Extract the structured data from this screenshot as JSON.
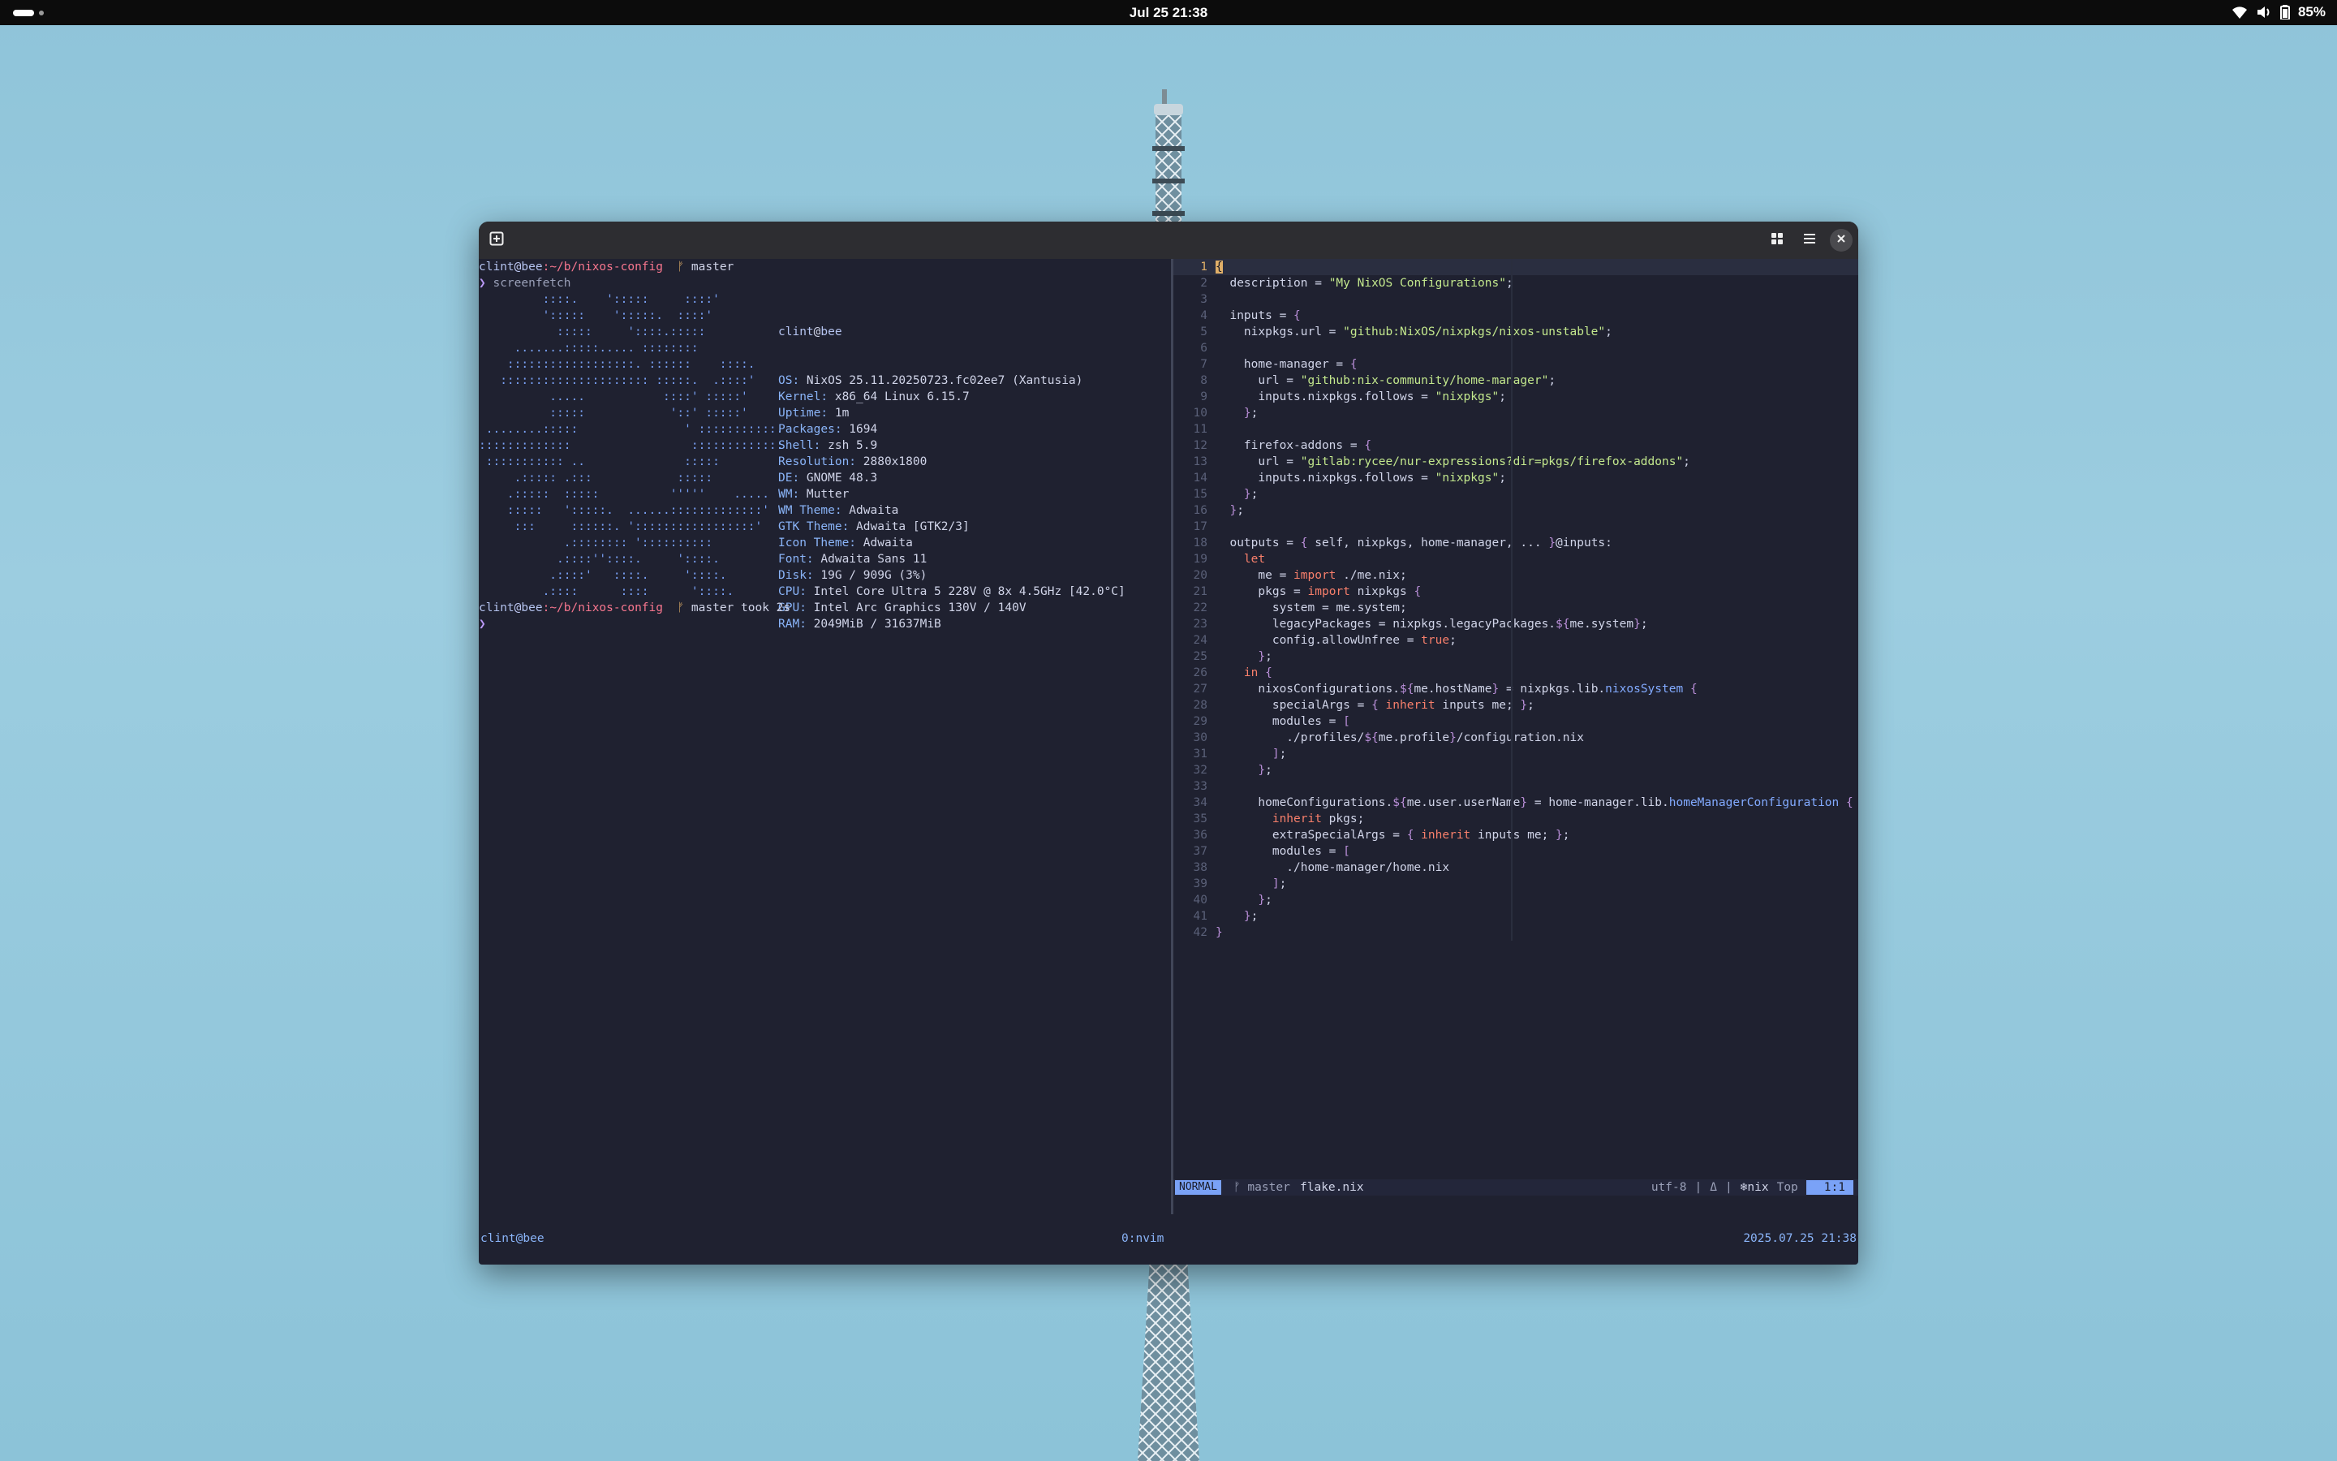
{
  "topbar": {
    "clock": "Jul 25  21:38",
    "battery": "85%"
  },
  "terminal": {
    "prompt1": {
      "user": "clint",
      "at": "@",
      "host": "bee",
      "path": ":~/b/nixos-config",
      "git_icon": "ᚠ",
      "branch": "master"
    },
    "cmd_arrow": "❯",
    "command": "screenfetch",
    "logo_lines": [
      "         ::::.    ':::::     ::::'",
      "         ':::::    ':::::.  ::::'",
      "           :::::     '::::.:::::",
      "     .......:::::..... ::::::::",
      "    ::::::::::::::::::. ::::::    ::::.",
      "   ::::::::::::::::::::: :::::.  .::::'",
      "          .....           ::::' :::::'",
      "          :::::            '::' :::::'",
      " ........:::::               ' :::::::::::.",
      ":::::::::::::                 :::::::::::::",
      " ::::::::::: ..              :::::",
      "     .::::: .:::            :::::",
      "    .:::::  :::::          '''''    .....",
      "    :::::   ':::::.  ......:::::::::::::'",
      "     :::     ::::::. ':::::::::::::::::'",
      "            .:::::::: '::::::::::",
      "           .::::''::::.     '::::.",
      "          .::::'   ::::.     '::::.",
      "         .::::      ::::      '::::."
    ],
    "info_title_user": "clint",
    "info_title_at": "@",
    "info_title_host": "bee",
    "info": [
      {
        "key": "OS:",
        "value": " NixOS 25.11.20250723.fc02ee7 (Xantusia)"
      },
      {
        "key": "Kernel:",
        "value": " x86_64 Linux 6.15.7"
      },
      {
        "key": "Uptime:",
        "value": " 1m"
      },
      {
        "key": "Packages:",
        "value": " 1694"
      },
      {
        "key": "Shell:",
        "value": " zsh 5.9"
      },
      {
        "key": "Resolution:",
        "value": " 2880x1800"
      },
      {
        "key": "DE:",
        "value": " GNOME 48.3"
      },
      {
        "key": "WM:",
        "value": " Mutter"
      },
      {
        "key": "WM Theme:",
        "value": " Adwaita"
      },
      {
        "key": "GTK Theme:",
        "value": " Adwaita [GTK2/3]"
      },
      {
        "key": "Icon Theme:",
        "value": " Adwaita"
      },
      {
        "key": "Font:",
        "value": " Adwaita Sans 11"
      },
      {
        "key": "Disk:",
        "value": " 19G / 909G (3%)"
      },
      {
        "key": "CPU:",
        "value": " Intel Core Ultra 5 228V @ 8x 4.5GHz [42.0°C]"
      },
      {
        "key": "GPU:",
        "value": " Intel Arc Graphics 130V / 140V"
      },
      {
        "key": "RAM:",
        "value": " 2049MiB / 31637MiB"
      }
    ],
    "prompt2_took": " took 2s"
  },
  "editor": {
    "line_numbers": [
      "1",
      "2",
      "3",
      "4",
      "5",
      "6",
      "7",
      "8",
      "9",
      "10",
      "11",
      "12",
      "13",
      "14",
      "15",
      "16",
      "17",
      "18",
      "19",
      "20",
      "21",
      "22",
      "23",
      "24",
      "25",
      "26",
      "27",
      "28",
      "29",
      "30",
      "31",
      "32",
      "33",
      "34",
      "35",
      "36",
      "37",
      "38",
      "39",
      "40",
      "41",
      "42"
    ],
    "code": [
      [
        [
          "p",
          "{"
        ]
      ],
      [
        [
          "w",
          "  description = "
        ],
        [
          "g",
          "\"My NixOS Configurations\""
        ],
        [
          "w",
          ";"
        ]
      ],
      [
        [
          "w",
          ""
        ]
      ],
      [
        [
          "w",
          "  inputs = "
        ],
        [
          "p",
          "{"
        ]
      ],
      [
        [
          "w",
          "    nixpkgs.url = "
        ],
        [
          "g",
          "\"github:NixOS/nixpkgs/nixos-unstable\""
        ],
        [
          "w",
          ";"
        ]
      ],
      [
        [
          "w",
          ""
        ]
      ],
      [
        [
          "w",
          "    home-manager = "
        ],
        [
          "p",
          "{"
        ]
      ],
      [
        [
          "w",
          "      url = "
        ],
        [
          "g",
          "\"github:nix-community/home-manager\""
        ],
        [
          "w",
          ";"
        ]
      ],
      [
        [
          "w",
          "      inputs.nixpkgs.follows = "
        ],
        [
          "g",
          "\"nixpkgs\""
        ],
        [
          "w",
          ";"
        ]
      ],
      [
        [
          "w",
          "    "
        ],
        [
          "p",
          "}"
        ],
        [
          "w",
          ";"
        ]
      ],
      [
        [
          "w",
          ""
        ]
      ],
      [
        [
          "w",
          "    firefox-addons = "
        ],
        [
          "p",
          "{"
        ]
      ],
      [
        [
          "w",
          "      url = "
        ],
        [
          "g",
          "\"gitlab:rycee/nur-expressions?dir=pkgs/firefox-addons\""
        ],
        [
          "w",
          ";"
        ]
      ],
      [
        [
          "w",
          "      inputs.nixpkgs.follows = "
        ],
        [
          "g",
          "\"nixpkgs\""
        ],
        [
          "w",
          ";"
        ]
      ],
      [
        [
          "w",
          "    "
        ],
        [
          "p",
          "}"
        ],
        [
          "w",
          ";"
        ]
      ],
      [
        [
          "w",
          "  "
        ],
        [
          "p",
          "}"
        ],
        [
          "w",
          ";"
        ]
      ],
      [
        [
          "w",
          ""
        ]
      ],
      [
        [
          "w",
          "  outputs = "
        ],
        [
          "p",
          "{"
        ],
        [
          "w",
          " self, nixpkgs, home-manager, ... "
        ],
        [
          "p",
          "}"
        ],
        [
          "w",
          "@inputs:"
        ]
      ],
      [
        [
          "w",
          "    "
        ],
        [
          "k",
          "let"
        ]
      ],
      [
        [
          "w",
          "      me = "
        ],
        [
          "k",
          "import"
        ],
        [
          "w",
          " ./me.nix;"
        ]
      ],
      [
        [
          "w",
          "      pkgs = "
        ],
        [
          "k",
          "import"
        ],
        [
          "w",
          " nixpkgs "
        ],
        [
          "p",
          "{"
        ]
      ],
      [
        [
          "w",
          "        system = me.system;"
        ]
      ],
      [
        [
          "w",
          "        legacyPackages = nixpkgs.legacyPackages."
        ],
        [
          "p",
          "${"
        ],
        [
          "w",
          "me.system"
        ],
        [
          "p",
          "}"
        ],
        [
          "w",
          ";"
        ]
      ],
      [
        [
          "w",
          "        config.allowUnfree = "
        ],
        [
          "k",
          "true"
        ],
        [
          "w",
          ";"
        ]
      ],
      [
        [
          "w",
          "      "
        ],
        [
          "p",
          "}"
        ],
        [
          "w",
          ";"
        ]
      ],
      [
        [
          "w",
          "    "
        ],
        [
          "k",
          "in"
        ],
        [
          "w",
          " "
        ],
        [
          "p",
          "{"
        ]
      ],
      [
        [
          "w",
          "      nixosConfigurations."
        ],
        [
          "p",
          "${"
        ],
        [
          "w",
          "me.hostName"
        ],
        [
          "p",
          "}"
        ],
        [
          "w",
          " = nixpkgs.lib."
        ],
        [
          "b",
          "nixosSystem"
        ],
        [
          "w",
          " "
        ],
        [
          "p",
          "{"
        ]
      ],
      [
        [
          "w",
          "        specialArgs = "
        ],
        [
          "p",
          "{"
        ],
        [
          "w",
          " "
        ],
        [
          "k",
          "inherit"
        ],
        [
          "w",
          " inputs me; "
        ],
        [
          "p",
          "}"
        ],
        [
          "w",
          ";"
        ]
      ],
      [
        [
          "w",
          "        modules = "
        ],
        [
          "p",
          "["
        ]
      ],
      [
        [
          "w",
          "          ./profiles/"
        ],
        [
          "p",
          "${"
        ],
        [
          "w",
          "me.profile"
        ],
        [
          "p",
          "}"
        ],
        [
          "w",
          "/configuration.nix"
        ]
      ],
      [
        [
          "w",
          "        "
        ],
        [
          "p",
          "]"
        ],
        [
          "w",
          ";"
        ]
      ],
      [
        [
          "w",
          "      "
        ],
        [
          "p",
          "}"
        ],
        [
          "w",
          ";"
        ]
      ],
      [
        [
          "w",
          ""
        ]
      ],
      [
        [
          "w",
          "      homeConfigurations."
        ],
        [
          "p",
          "${"
        ],
        [
          "w",
          "me.user.userName"
        ],
        [
          "p",
          "}"
        ],
        [
          "w",
          " = home-manager.lib."
        ],
        [
          "b",
          "homeManagerConfiguration"
        ],
        [
          "w",
          " "
        ],
        [
          "p",
          "{"
        ]
      ],
      [
        [
          "w",
          "        "
        ],
        [
          "k",
          "inherit"
        ],
        [
          "w",
          " pkgs;"
        ]
      ],
      [
        [
          "w",
          "        extraSpecialArgs = "
        ],
        [
          "p",
          "{"
        ],
        [
          "w",
          " "
        ],
        [
          "k",
          "inherit"
        ],
        [
          "w",
          " inputs me; "
        ],
        [
          "p",
          "}"
        ],
        [
          "w",
          ";"
        ]
      ],
      [
        [
          "w",
          "        modules = "
        ],
        [
          "p",
          "["
        ]
      ],
      [
        [
          "w",
          "          ./home-manager/home.nix"
        ]
      ],
      [
        [
          "w",
          "        "
        ],
        [
          "p",
          "]"
        ],
        [
          "w",
          ";"
        ]
      ],
      [
        [
          "w",
          "      "
        ],
        [
          "p",
          "}"
        ],
        [
          "w",
          ";"
        ]
      ],
      [
        [
          "w",
          "    "
        ],
        [
          "p",
          "}"
        ],
        [
          "w",
          ";"
        ]
      ],
      [
        [
          "p",
          "}"
        ]
      ]
    ],
    "status": {
      "mode": "NORMAL",
      "branch": "ᚠ master",
      "file": "flake.nix",
      "encoding": "utf-8",
      "sep": "|",
      "os_icon": "Δ",
      "filetype": "❄nix",
      "scroll": "Top",
      "position": "1:1"
    }
  },
  "tmux": {
    "session": "clint@bee",
    "window": "0:nvim",
    "datetime": "2025.07.25 21:38"
  },
  "colors": {
    "terminal_bg": "#1f2130",
    "accent_blue": "#7aa2f7",
    "string_green": "#c3e88d",
    "keyword": "#f77f6b",
    "path_red": "#f7768e"
  }
}
